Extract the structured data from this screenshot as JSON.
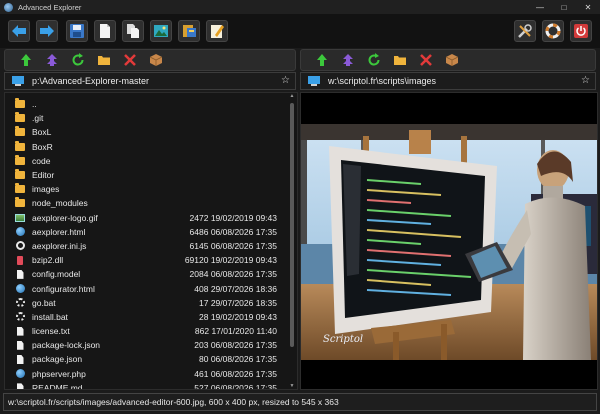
{
  "window": {
    "title": "Advanced Explorer",
    "min_glyph": "—",
    "max_glyph": "□",
    "close_glyph": "✕"
  },
  "left": {
    "path": "p:\\Advanced-Explorer-master",
    "files": [
      {
        "name": "..",
        "meta": "",
        "icon": "folder"
      },
      {
        "name": ".git",
        "meta": "",
        "icon": "folder"
      },
      {
        "name": "BoxL",
        "meta": "",
        "icon": "folder"
      },
      {
        "name": "BoxR",
        "meta": "",
        "icon": "folder"
      },
      {
        "name": "code",
        "meta": "",
        "icon": "folder"
      },
      {
        "name": "Editor",
        "meta": "",
        "icon": "folder"
      },
      {
        "name": "images",
        "meta": "",
        "icon": "folder"
      },
      {
        "name": "node_modules",
        "meta": "",
        "icon": "folder"
      },
      {
        "name": "aexplorer-logo.gif",
        "meta": "2472 19/02/2019 09:43",
        "icon": "img"
      },
      {
        "name": "aexplorer.html",
        "meta": "6486 06/08/2026 17:35",
        "icon": "globe"
      },
      {
        "name": "aexplorer.ini.js",
        "meta": "6145 06/08/2026 17:35",
        "icon": "ring"
      },
      {
        "name": "bzip2.dll",
        "meta": "69120 19/02/2019 09:43",
        "icon": "dll"
      },
      {
        "name": "config.model",
        "meta": "2084 06/08/2026 17:35",
        "icon": "doc"
      },
      {
        "name": "configurator.html",
        "meta": "408 29/07/2026 18:36",
        "icon": "globe"
      },
      {
        "name": "go.bat",
        "meta": "17 29/07/2026 18:35",
        "icon": "gear"
      },
      {
        "name": "install.bat",
        "meta": "28 19/02/2019 09:43",
        "icon": "gear"
      },
      {
        "name": "license.txt",
        "meta": "862 17/01/2020 11:40",
        "icon": "doc"
      },
      {
        "name": "package-lock.json",
        "meta": "203 06/08/2026 17:35",
        "icon": "doc"
      },
      {
        "name": "package.json",
        "meta": "80 06/08/2026 17:35",
        "icon": "doc"
      },
      {
        "name": "phpserver.php",
        "meta": "461 06/08/2026 17:35",
        "icon": "globe"
      },
      {
        "name": "README.md",
        "meta": "527 06/08/2026 17:35",
        "icon": "doc"
      }
    ]
  },
  "right": {
    "path": "w:\\scriptol.fr\\scripts\\images",
    "image_caption": "Scriptol"
  },
  "status": {
    "text": "w:\\scriptol.fr/scripts/images/advanced-editor-600.jpg, 600 x 400 px, resized to 545 x 363"
  },
  "star_glyph": "☆"
}
